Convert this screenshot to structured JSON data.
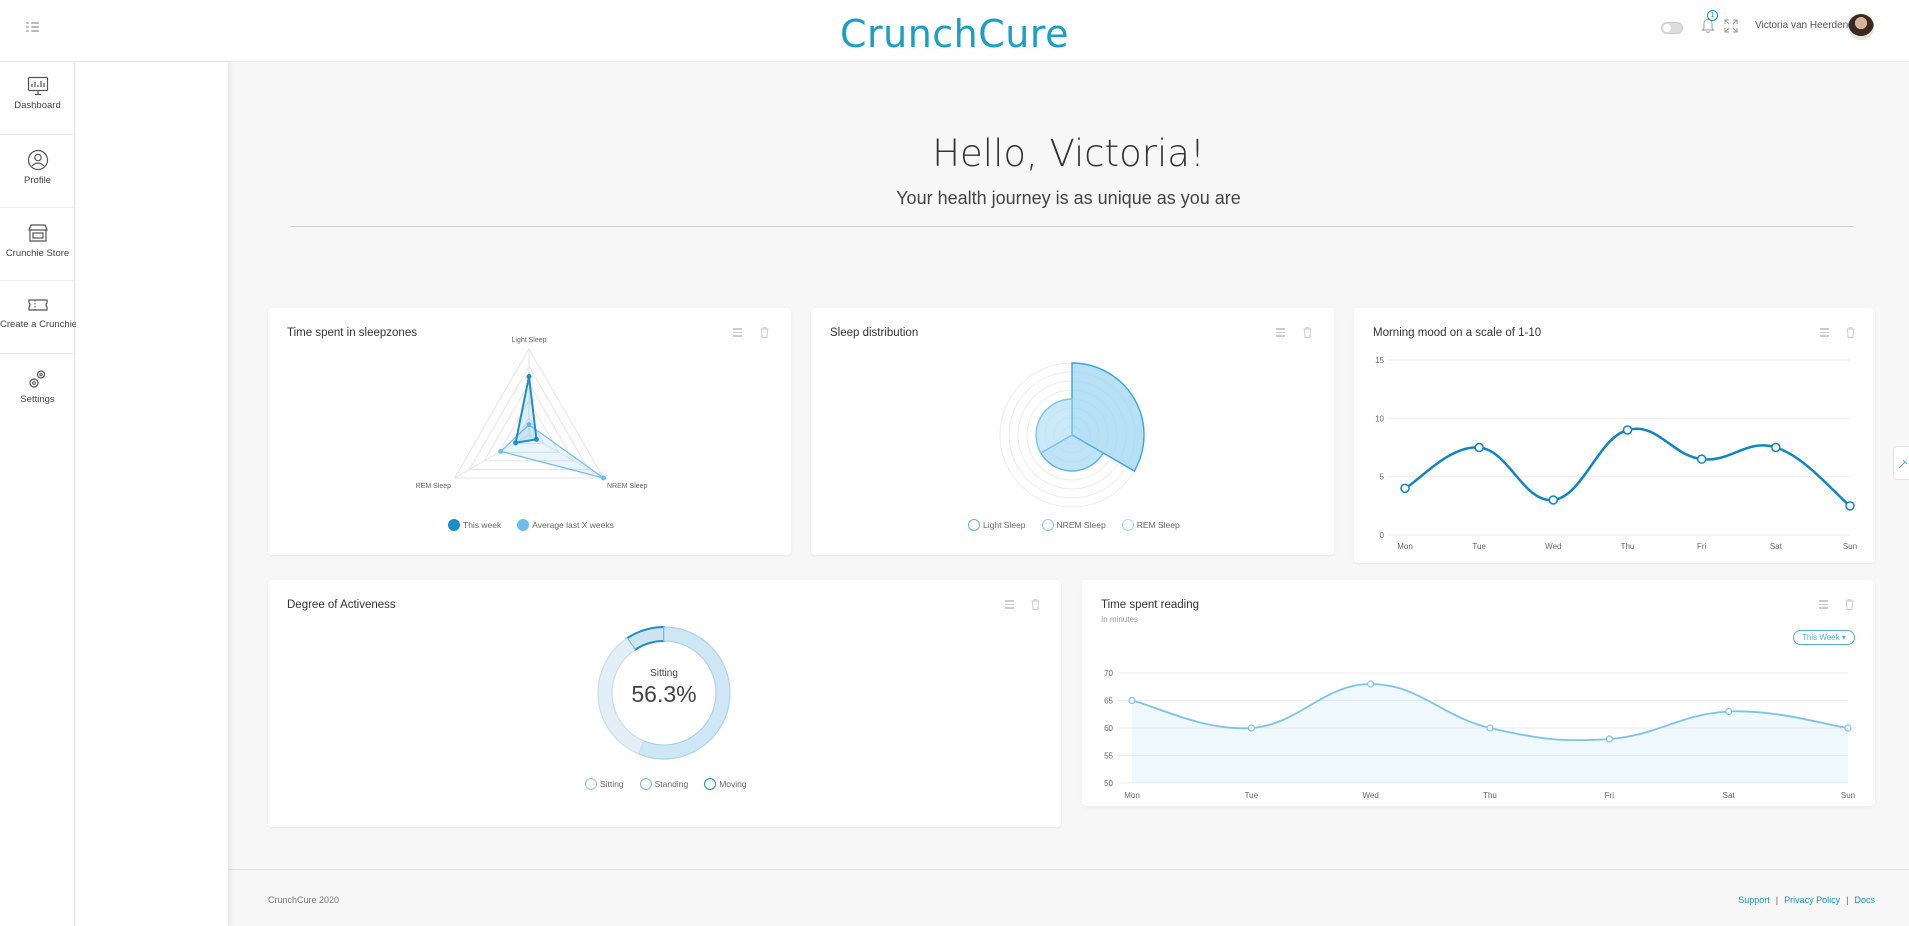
{
  "app": {
    "brand": "CrunchCure"
  },
  "header": {
    "username": "Victoria van Heerden",
    "notification_count": "1"
  },
  "sidebar": {
    "items": [
      {
        "label": "Dashboard",
        "icon": "dashboard-icon"
      },
      {
        "label": "Profile",
        "icon": "profile-icon"
      },
      {
        "label": "Crunchie Store",
        "icon": "store-icon"
      },
      {
        "label": "Create a Crunchie",
        "icon": "ticket-icon"
      },
      {
        "label": "Settings",
        "icon": "gears-icon"
      }
    ]
  },
  "hero": {
    "title": "Hello, Victoria!",
    "subtitle": "Your health journey is as unique as you are"
  },
  "cards": {
    "sleepzones": {
      "title": "Time spent in sleepzones",
      "axes": [
        "Light Sleep",
        "NREM Sleep",
        "REM Sleep"
      ],
      "legend": [
        "This week",
        "Average last X weeks"
      ]
    },
    "distribution": {
      "title": "Sleep distribution",
      "legend": [
        "Light Sleep",
        "NREM Sleep",
        "REM Sleep"
      ]
    },
    "mood": {
      "title": "Morning mood on a scale of 1-10"
    },
    "activeness": {
      "title": "Degree of Activeness",
      "center_label": "Sitting",
      "center_value": "56.3%",
      "legend": [
        "Sitting",
        "Standing",
        "Moving"
      ]
    },
    "reading": {
      "title": "Time spent reading",
      "subtitle": "In minutes",
      "filter_label": "This Week"
    }
  },
  "chart_data": [
    {
      "id": "sleepzones",
      "type": "radar",
      "axes": [
        "Light Sleep",
        "NREM Sleep",
        "REM Sleep"
      ],
      "series": [
        {
          "name": "This week",
          "values": [
            0.68,
            0.1,
            0.18
          ]
        },
        {
          "name": "Average last X weeks",
          "values": [
            0.12,
            1.0,
            0.38
          ]
        }
      ],
      "colors": [
        "#1a8fc8",
        "#6dbef0"
      ]
    },
    {
      "id": "distribution",
      "type": "polar-area",
      "categories": [
        "Light Sleep",
        "NREM Sleep",
        "REM Sleep"
      ],
      "values": [
        1.0,
        0.5,
        0.5
      ],
      "colors": [
        "#9fd5f2",
        "#a9daf4",
        "#b8e1f6"
      ]
    },
    {
      "id": "mood",
      "type": "line",
      "categories": [
        "Mon",
        "Tue",
        "Wed",
        "Thu",
        "Fri",
        "Sat",
        "Sun"
      ],
      "values": [
        4,
        7.5,
        3,
        9,
        6.5,
        7.5,
        2.5
      ],
      "ylim": [
        0,
        15
      ],
      "yticks": [
        0,
        5,
        10,
        15
      ],
      "color": "#0e86c2"
    },
    {
      "id": "activeness",
      "type": "donut",
      "categories": [
        "Sitting",
        "Standing",
        "Moving"
      ],
      "values": [
        56.3,
        34.2,
        9.5
      ],
      "colors": [
        "#cfe6f5",
        "#e3eef6",
        "#cde4f3"
      ]
    },
    {
      "id": "reading",
      "type": "area",
      "categories": [
        "Mon",
        "Tue",
        "Wed",
        "Thu",
        "Fri",
        "Sat",
        "Sun"
      ],
      "values": [
        65,
        60,
        68,
        60,
        58,
        63,
        60
      ],
      "ylim": [
        50,
        70
      ],
      "yticks": [
        50,
        55,
        60,
        65,
        70
      ],
      "color": "#7cc4ee"
    }
  ],
  "footer": {
    "copyright": "CrunchCure 2020",
    "links": [
      "Support",
      "Privacy Policy",
      "Docs"
    ]
  }
}
